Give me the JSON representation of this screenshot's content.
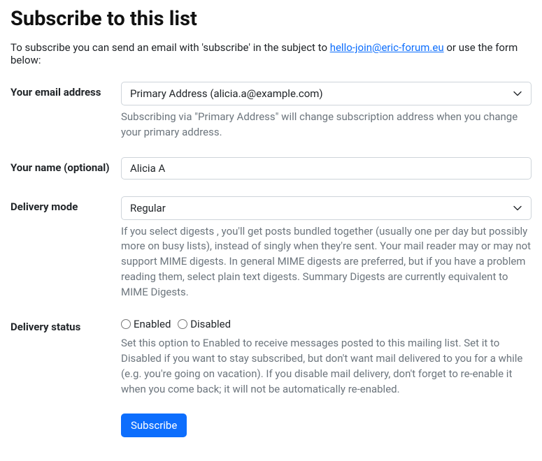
{
  "title": "Subscribe to this list",
  "intro": {
    "prefix": "To subscribe you can send an email with 'subscribe' in the subject to ",
    "email": "hello-join@eric-forum.eu",
    "suffix": " or use the form below:"
  },
  "fields": {
    "email": {
      "label": "Your email address",
      "selected": "Primary Address (alicia.a@example.com)",
      "help": "Subscribing via \"Primary Address\" will change subscription address when you change your primary address."
    },
    "name": {
      "label": "Your name (optional)",
      "value": "Alicia A"
    },
    "delivery_mode": {
      "label": "Delivery mode",
      "selected": "Regular",
      "help": "If you select digests , you'll get posts bundled together (usually one per day but possibly more on busy lists), instead of singly when they're sent. Your mail reader may or may not support MIME digests. In general MIME digests are preferred, but if you have a problem reading them, select plain text digests. Summary Digests are currently equivalent to MIME Digests."
    },
    "delivery_status": {
      "label": "Delivery status",
      "options": {
        "enabled": "Enabled",
        "disabled": "Disabled"
      },
      "help": "Set this option to Enabled to receive messages posted to this mailing list. Set it to Disabled if you want to stay subscribed, but don't want mail delivered to you for a while (e.g. you're going on vacation). If you disable mail delivery, don't forget to re-enable it when you come back; it will not be automatically re-enabled."
    }
  },
  "submit": "Subscribe"
}
